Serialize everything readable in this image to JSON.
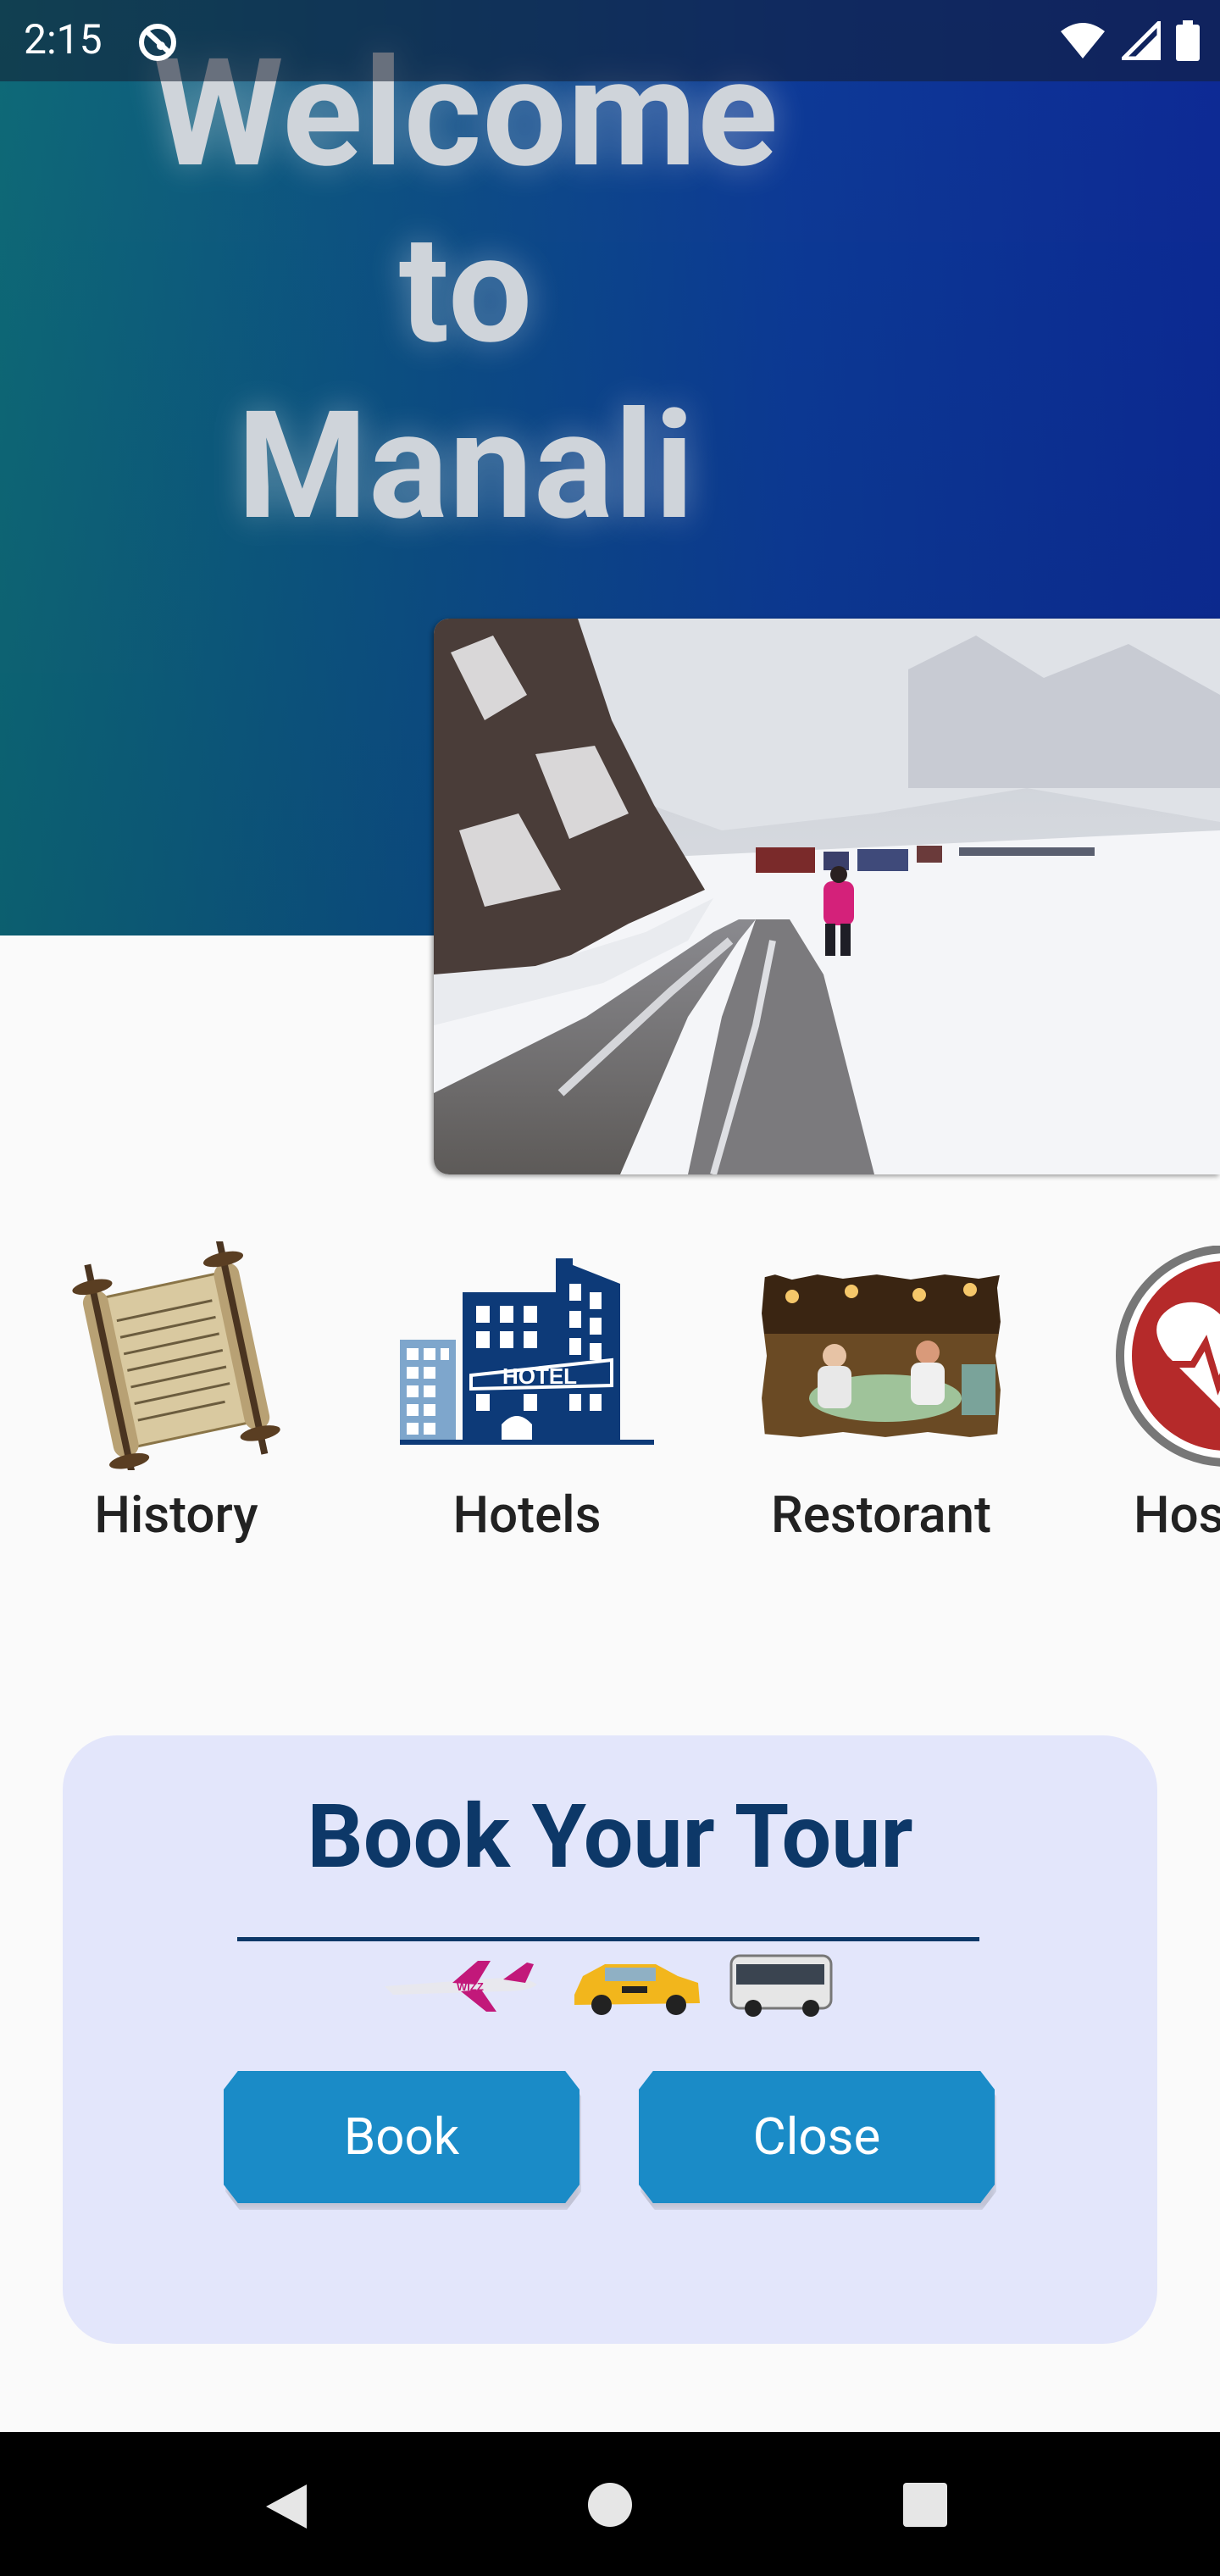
{
  "status_bar": {
    "time": "2:15"
  },
  "hero": {
    "line1": "Welcome",
    "line2": "to",
    "line3": "Manali"
  },
  "categories": [
    {
      "label": "History",
      "icon": "scroll-icon"
    },
    {
      "label": "Hotels",
      "icon": "hotel-icon"
    },
    {
      "label": "Restorant",
      "icon": "restaurant-photo-icon"
    },
    {
      "label": "Hos",
      "icon": "hospital-heart-icon"
    }
  ],
  "hotel_sign": "HOTEL",
  "book_card": {
    "title": "Book Your Tour",
    "book_label": "Book",
    "close_label": "Close",
    "plane_text": "WIZZ"
  },
  "colors": {
    "hero_start": "#0e6a78",
    "hero_end": "#0d2a96",
    "card_bg": "#e3e6fb",
    "title": "#0d3868",
    "button": "#1a8bc7"
  }
}
